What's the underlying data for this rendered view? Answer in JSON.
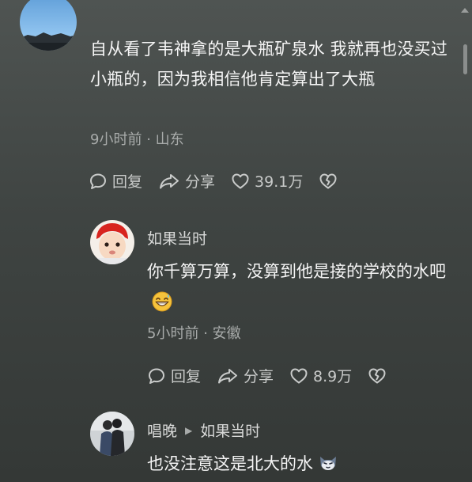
{
  "main_comment": {
    "text": "自从看了韦神拿的是大瓶矿泉水 我就再也没买过小瓶的，因为我相信他肯定算出了大瓶",
    "time": "9小时前",
    "location": "山东",
    "reply_label": "回复",
    "share_label": "分享",
    "likes": "39.1万"
  },
  "replies": [
    {
      "username": "如果当时",
      "text": "你千算万算，没算到他是接的学校的水吧",
      "time": "5小时前",
      "location": "安徽",
      "reply_label": "回复",
      "share_label": "分享",
      "likes": "8.9万"
    },
    {
      "username": "唱晚",
      "reply_to": "如果当时",
      "text": "也没注意这是北大的水"
    }
  ],
  "meta_separator": "·",
  "icons": {
    "reply": "comment-bubble-icon",
    "share": "share-arrow-icon",
    "like": "heart-icon",
    "dislike": "broken-heart-icon",
    "reply_to": "triangle-right-icon"
  }
}
